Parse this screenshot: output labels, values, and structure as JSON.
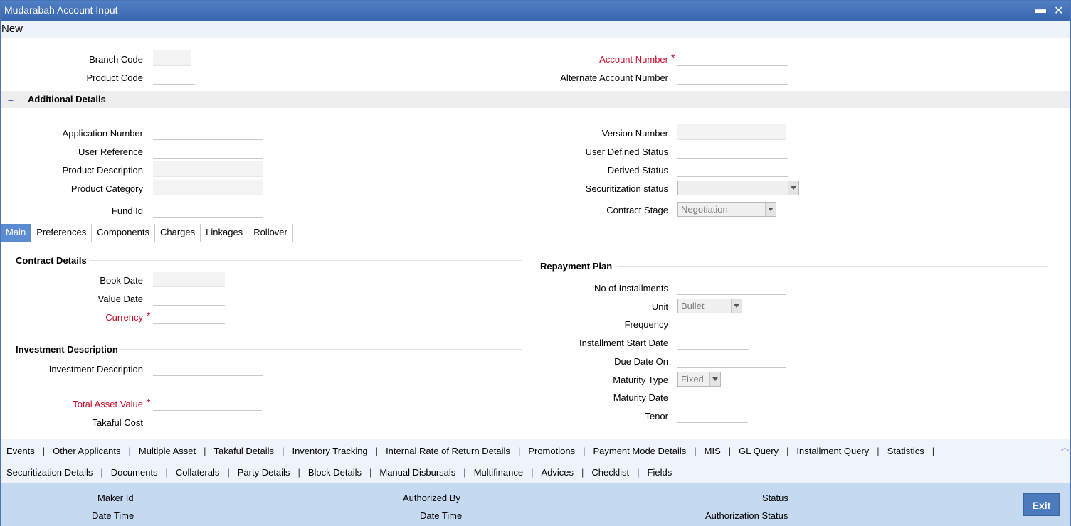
{
  "window": {
    "title": "Mudarabah Account Input",
    "minimize": "▬",
    "close": "✕"
  },
  "toolbar": {
    "new_label": "New"
  },
  "header": {
    "branch_code": "Branch Code",
    "product_code": "Product Code",
    "account_number": "Account Number",
    "alternate_account_number": "Alternate Account Number",
    "required": "*"
  },
  "additional": {
    "title": "Additional Details",
    "toggle": "–",
    "application_number": "Application Number",
    "user_reference": "User Reference",
    "product_description": "Product Description",
    "product_category": "Product Category",
    "fund_id": "Fund Id",
    "version_number": "Version Number",
    "user_defined_status": "User Defined Status",
    "derived_status": "Derived Status",
    "securitization_status": "Securitization status",
    "contract_stage": "Contract Stage",
    "contract_stage_value": "Negotiation"
  },
  "tabs": [
    "Main",
    "Preferences",
    "Components",
    "Charges",
    "Linkages",
    "Rollover"
  ],
  "contract": {
    "title": "Contract Details",
    "book_date": "Book Date",
    "value_date": "Value Date",
    "currency": "Currency"
  },
  "investment": {
    "title": "Investment Description",
    "investment_description": "Investment Description",
    "total_asset_value": "Total Asset Value",
    "takaful_cost": "Takaful Cost"
  },
  "repayment": {
    "title": "Repayment Plan",
    "no_of_installments": "No of Installments",
    "unit": "Unit",
    "unit_value": "Bullet",
    "frequency": "Frequency",
    "installment_start_date": "Installment Start Date",
    "due_date_on": "Due Date On",
    "maturity_type": "Maturity Type",
    "maturity_type_value": "Fixed",
    "maturity_date": "Maturity Date",
    "tenor": "Tenor"
  },
  "links_row1": [
    "Events",
    "Other Applicants",
    "Multiple Asset",
    "Takaful Details",
    "Inventory Tracking",
    "Internal Rate of Return Details",
    "Promotions",
    "Payment Mode Details",
    "MIS",
    "GL Query",
    "Installment Query",
    "Statistics"
  ],
  "links_row2": [
    "Securitization Details",
    "Documents",
    "Collaterals",
    "Party Details",
    "Block Details",
    "Manual Disbursals",
    "Multifinance",
    "Advices",
    "Checklist",
    "Fields"
  ],
  "link_separator": "|",
  "footer": {
    "maker_id": "Maker Id",
    "date_time_1": "Date Time",
    "authorized_by": "Authorized By",
    "date_time_2": "Date Time",
    "status": "Status",
    "authorization_status": "Authorization Status",
    "exit_label": "Exit"
  }
}
